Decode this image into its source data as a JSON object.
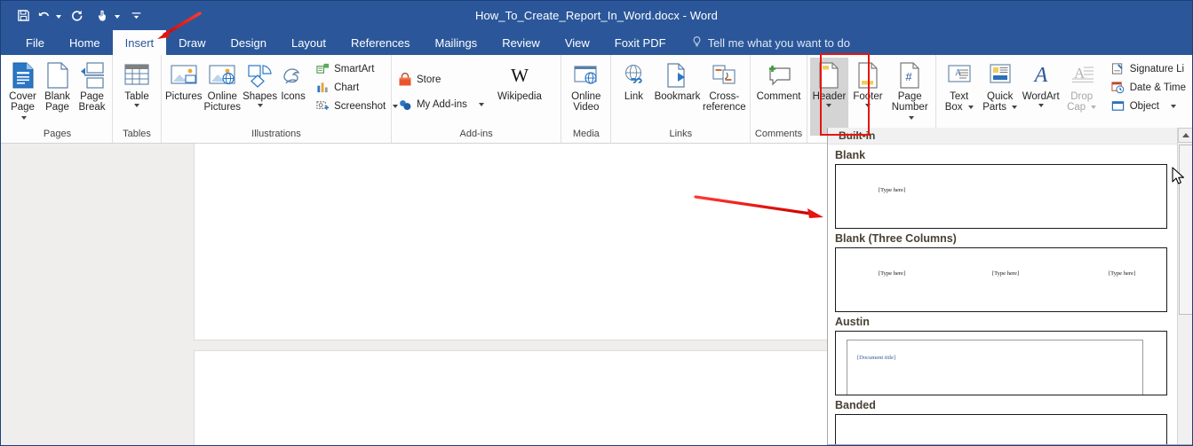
{
  "window": {
    "title": "How_To_Create_Report_In_Word.docx  -  Word"
  },
  "quick_access": {
    "items": [
      {
        "name": "save",
        "icon": "save-icon",
        "has_caret": false
      },
      {
        "name": "undo",
        "icon": "undo-icon",
        "has_caret": true
      },
      {
        "name": "redo",
        "icon": "redo-icon",
        "has_caret": false
      },
      {
        "name": "touch-mouse-mode",
        "icon": "touch-mode-icon",
        "has_caret": true
      },
      {
        "name": "customize-quick-access-toolbar",
        "icon": "customize-qat-icon",
        "has_caret": false
      }
    ]
  },
  "tabs": [
    {
      "label": "File",
      "active": false
    },
    {
      "label": "Home",
      "active": false
    },
    {
      "label": "Insert",
      "active": true
    },
    {
      "label": "Draw",
      "active": false
    },
    {
      "label": "Design",
      "active": false
    },
    {
      "label": "Layout",
      "active": false
    },
    {
      "label": "References",
      "active": false
    },
    {
      "label": "Mailings",
      "active": false
    },
    {
      "label": "Review",
      "active": false
    },
    {
      "label": "View",
      "active": false
    },
    {
      "label": "Foxit PDF",
      "active": false
    }
  ],
  "tell_me": {
    "label": "Tell me what you want to do",
    "icon": "lightbulb-icon"
  },
  "ribbon": {
    "groups": [
      {
        "label": "Pages",
        "buttons": [
          {
            "label": "Cover Page",
            "icon": "cover-page-icon",
            "caret": "inline"
          },
          {
            "label": "Blank Page",
            "icon": "blank-page-icon",
            "caret": "none"
          },
          {
            "label": "Page Break",
            "icon": "page-break-icon",
            "caret": "none"
          }
        ]
      },
      {
        "label": "Tables",
        "buttons": [
          {
            "label": "Table",
            "icon": "table-icon",
            "caret": "below"
          }
        ]
      },
      {
        "label": "Illustrations",
        "buttons": [
          {
            "label": "Pictures",
            "icon": "pictures-icon",
            "caret": "none"
          },
          {
            "label": "Online Pictures",
            "icon": "online-pictures-icon",
            "caret": "none"
          },
          {
            "label": "Shapes",
            "icon": "shapes-icon",
            "caret": "below"
          },
          {
            "label": "Icons",
            "icon": "icons-icon",
            "caret": "none"
          }
        ],
        "small_buttons": [
          {
            "label": "SmartArt",
            "icon": "smartart-icon",
            "caret": false
          },
          {
            "label": "Chart",
            "icon": "chart-icon",
            "caret": false
          },
          {
            "label": "Screenshot",
            "icon": "screenshot-icon",
            "caret": true
          }
        ]
      },
      {
        "label": "Add-ins",
        "small_buttons": [
          {
            "label": "Store",
            "icon": "store-icon",
            "caret": false
          },
          {
            "label": "My Add-ins",
            "icon": "my-addins-icon",
            "caret": true
          }
        ],
        "buttons": [
          {
            "label": "Wikipedia",
            "icon": "wikipedia-icon",
            "caret": "none"
          }
        ]
      },
      {
        "label": "Media",
        "buttons": [
          {
            "label": "Online Video",
            "icon": "online-video-icon",
            "caret": "none"
          }
        ]
      },
      {
        "label": "Links",
        "buttons": [
          {
            "label": "Link",
            "icon": "link-icon",
            "caret": "none"
          },
          {
            "label": "Bookmark",
            "icon": "bookmark-icon",
            "caret": "none"
          },
          {
            "label": "Cross-reference",
            "icon": "cross-reference-icon",
            "caret": "none"
          }
        ]
      },
      {
        "label": "Comments",
        "buttons": [
          {
            "label": "Comment",
            "icon": "comment-icon",
            "caret": "none"
          }
        ]
      },
      {
        "label": "",
        "buttons": [
          {
            "label": "Header",
            "icon": "header-icon",
            "caret": "below",
            "selected": true,
            "highlighted": true
          },
          {
            "label": "Footer",
            "icon": "footer-icon",
            "caret": "below"
          },
          {
            "label": "Page Number",
            "icon": "page-number-icon",
            "caret": "inline"
          }
        ]
      },
      {
        "label": "",
        "buttons": [
          {
            "label": "Text Box",
            "icon": "text-box-icon",
            "caret": "inline"
          },
          {
            "label": "Quick Parts",
            "icon": "quick-parts-icon",
            "caret": "inline"
          },
          {
            "label": "WordArt",
            "icon": "wordart-icon",
            "caret": "below"
          },
          {
            "label": "Drop Cap",
            "icon": "drop-cap-icon",
            "caret": "inline",
            "disabled": true
          }
        ],
        "small_buttons": [
          {
            "label": "Signature Li",
            "icon": "signature-line-icon",
            "caret": false
          },
          {
            "label": "Date & Time",
            "icon": "date-time-icon",
            "caret": false
          },
          {
            "label": "Object",
            "icon": "object-icon",
            "caret": true
          }
        ]
      }
    ]
  },
  "gallery": {
    "section_label": "Built-in",
    "items": [
      {
        "name": "Blank",
        "type": "blank",
        "placeholders": [
          "[Type here]"
        ]
      },
      {
        "name": "Blank (Three Columns)",
        "type": "three-columns",
        "placeholders": [
          "[Type here]",
          "[Type here]",
          "[Type here]"
        ]
      },
      {
        "name": "Austin",
        "type": "austin",
        "placeholders": [
          "[Document title]"
        ]
      },
      {
        "name": "Banded",
        "type": "banded",
        "placeholders": []
      }
    ]
  },
  "document": {
    "pages": [
      {
        "label": "page-1"
      },
      {
        "label": "page-2"
      }
    ]
  },
  "annotations": [
    {
      "name": "arrow-to-insert-tab",
      "color": "#e8140f"
    },
    {
      "name": "arrow-to-gallery",
      "color": "#e8140f"
    }
  ],
  "colors": {
    "brand": "#2b579a",
    "highlight": "#e8140f",
    "ribbon_bg": "#fdfdfd",
    "doc_bg": "#efeeec"
  }
}
